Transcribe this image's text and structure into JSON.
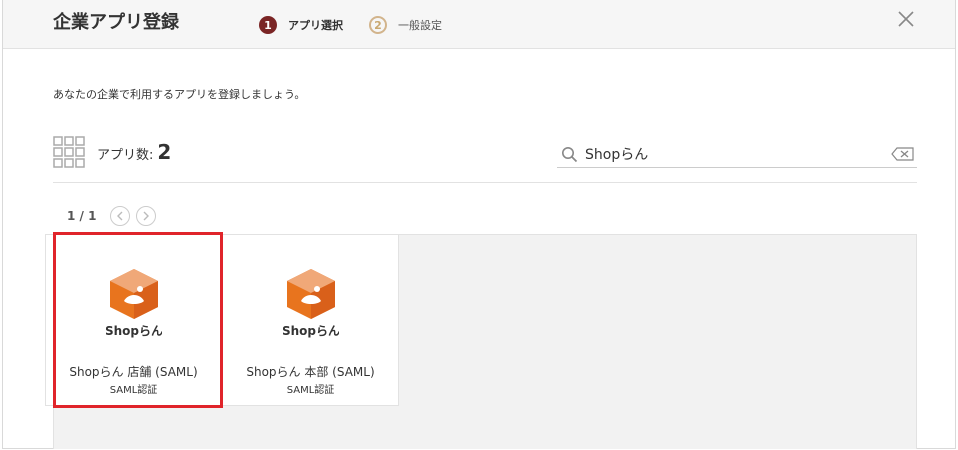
{
  "header": {
    "title": "企業アプリ登録",
    "steps": [
      {
        "num": "1",
        "label": "アプリ選択",
        "state": "active"
      },
      {
        "num": "2",
        "label": "一般設定",
        "state": "inactive"
      }
    ],
    "close_icon": "close-icon"
  },
  "body": {
    "description": "あなたの企業で利用するアプリを登録しましょう。",
    "app_count_label": "アプリ数:",
    "app_count": "2",
    "search": {
      "value": "Shopらん",
      "placeholder": ""
    },
    "pager": {
      "indicator": "1 / 1",
      "prev_icon": "chevron-left-icon",
      "next_icon": "chevron-right-icon"
    },
    "apps": [
      {
        "logo_text": "Shopらん",
        "name": "Shopらん 店舗 (SAML)",
        "auth": "SAML認証",
        "selected": true
      },
      {
        "logo_text": "Shopらん",
        "name": "Shopらん 本部 (SAML)",
        "auth": "SAML認証",
        "selected": false
      }
    ]
  },
  "colors": {
    "step_active": "#7a2525",
    "step_inactive": "#d2b48c",
    "highlight": "#e0242a",
    "logo_orange": "#e8741e",
    "logo_light": "#f0a878"
  }
}
